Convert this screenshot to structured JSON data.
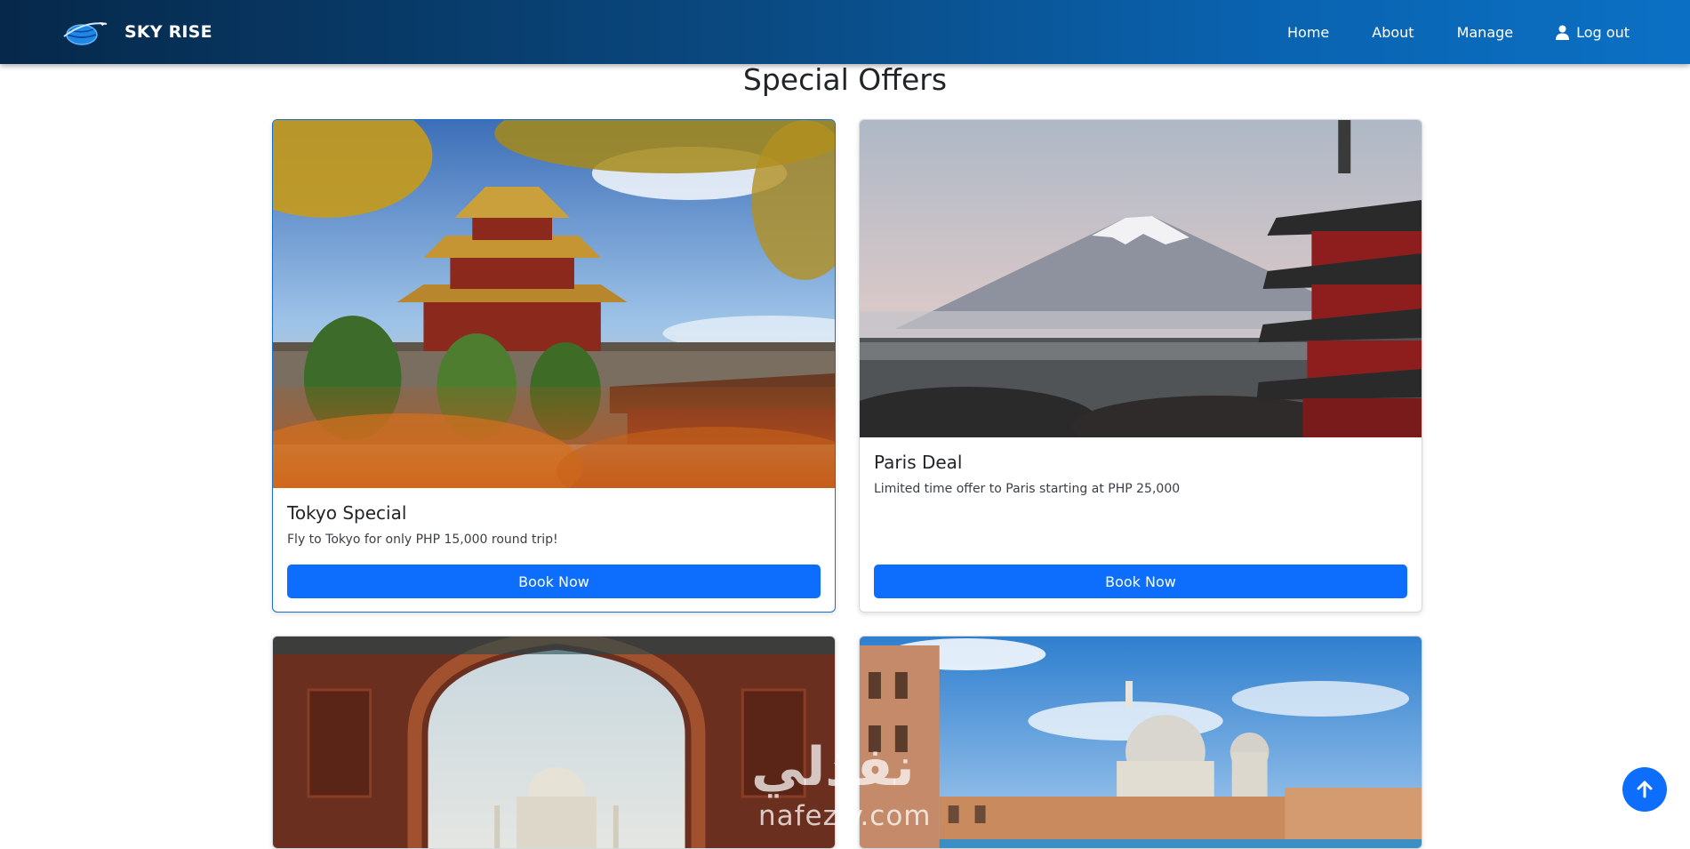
{
  "brand": {
    "name": "SKY RISE",
    "logo_icon": "globe-plane-icon"
  },
  "nav": {
    "items": [
      {
        "label": "Home"
      },
      {
        "label": "About"
      },
      {
        "label": "Manage"
      },
      {
        "label": "Log out",
        "icon": "user-icon"
      }
    ]
  },
  "page": {
    "title": "Special Offers"
  },
  "offers": [
    {
      "title": "Tokyo Special",
      "text": "Fly to Tokyo for only PHP 15,000 round trip!",
      "button": "Book Now",
      "image": "forbidden-city-photo"
    },
    {
      "title": "Paris Deal",
      "text": "Limited time offer to Paris starting at PHP 25,000",
      "button": "Book Now",
      "image": "mount-fuji-photo"
    },
    {
      "image": "taj-mahal-arch-photo"
    },
    {
      "image": "venice-photo"
    }
  ],
  "back_to_top": {
    "icon": "arrow-up-icon"
  },
  "watermark": {
    "arabic": "نفذلي",
    "latin": "nafezly.com"
  },
  "colors": {
    "primary": "#0d6efd",
    "navbar_start": "#06284a",
    "navbar_end": "#0b70c4"
  }
}
